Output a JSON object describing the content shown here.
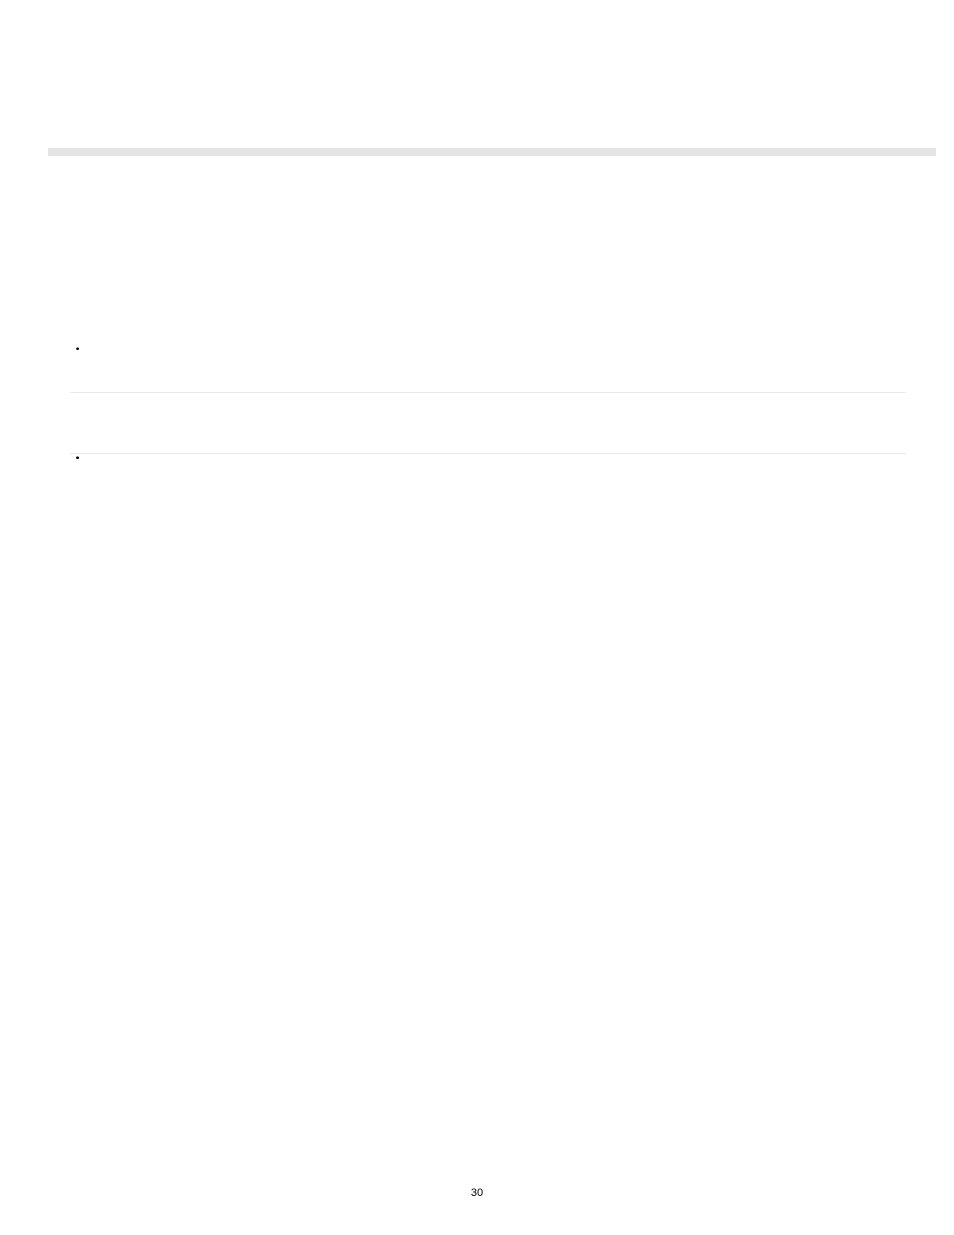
{
  "page_number": "30",
  "section1": {
    "items": [
      "",
      "",
      "",
      ""
    ]
  },
  "section2": {
    "items": [
      "",
      "",
      "",
      "",
      "",
      "",
      "",
      "",
      "",
      ""
    ]
  }
}
